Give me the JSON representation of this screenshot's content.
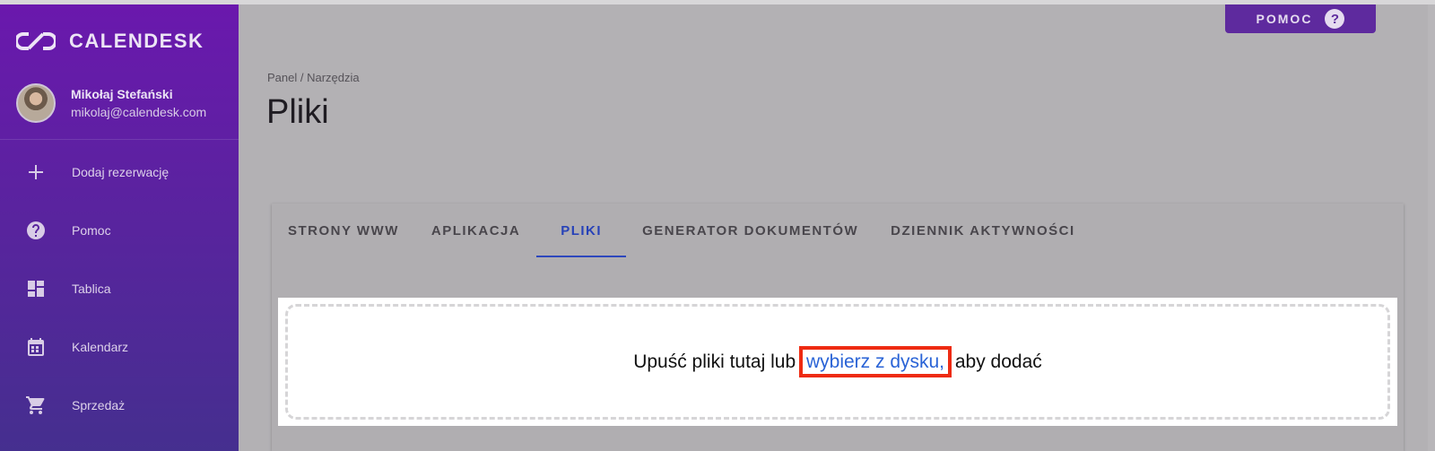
{
  "app": {
    "logo_text": "CALENDESK",
    "help_label": "POMOC",
    "help_icon": "?"
  },
  "user": {
    "name": "Mikołaj Stefański",
    "email": "mikolaj@calendesk.com"
  },
  "nav": [
    {
      "label": "Dodaj rezerwację",
      "icon": "plus-icon"
    },
    {
      "label": "Pomoc",
      "icon": "help-icon"
    },
    {
      "label": "Tablica",
      "icon": "dashboard-icon"
    },
    {
      "label": "Kalendarz",
      "icon": "calendar-icon"
    },
    {
      "label": "Sprzedaż",
      "icon": "cart-icon"
    }
  ],
  "breadcrumb": "Panel / Narzędzia",
  "page_title": "Pliki",
  "tabs": [
    {
      "label": "STRONY WWW",
      "active": false
    },
    {
      "label": "APLIKACJA",
      "active": false
    },
    {
      "label": "PLIKI",
      "active": true
    },
    {
      "label": "GENERATOR DOKUMENTÓW",
      "active": false
    },
    {
      "label": "DZIENNIK AKTYWNOŚCI",
      "active": false
    }
  ],
  "dropzone": {
    "text_before": "Upuść pliki tutaj lub",
    "link": "wybierz z dysku,",
    "text_after": "aby dodać"
  },
  "colors": {
    "sidebar_top": "#6a18ad",
    "sidebar_bottom": "#452f8f",
    "accent": "#2d47bd",
    "link": "#2a63d6",
    "highlight": "#ee2b12"
  }
}
